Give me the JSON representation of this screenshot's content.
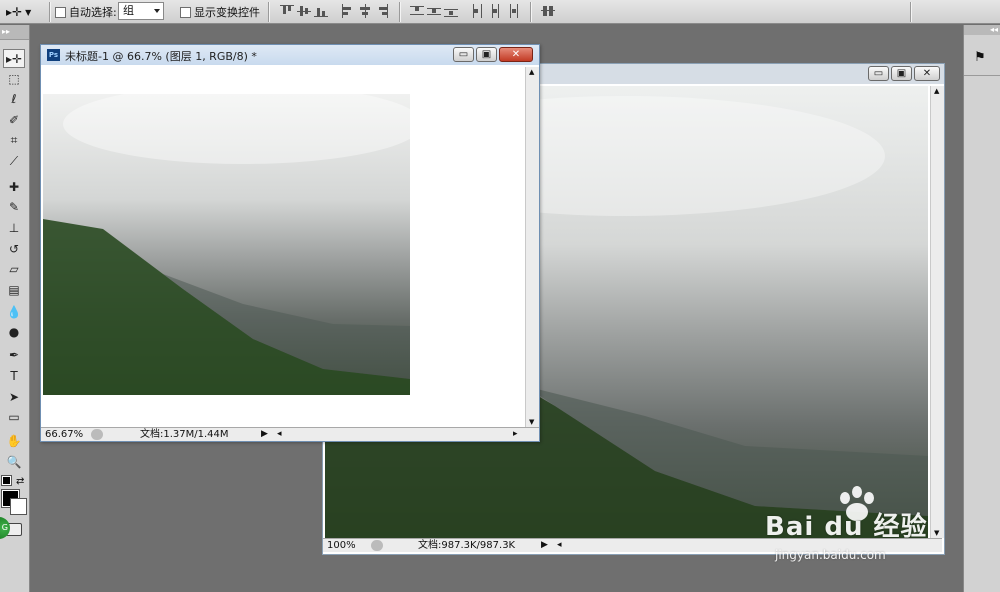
{
  "options_bar": {
    "move_tool_glyph": "▸✛",
    "auto_select_label": "自动选择:",
    "auto_select_value": "组",
    "show_transform_label": "显示变换控件"
  },
  "doc_front": {
    "title": "未标题-1 @ 66.7% (图层 1, RGB/8) *",
    "ps_badge": "Ps",
    "zoom": "66.67%",
    "doc_info": "文档:1.37M/1.44M"
  },
  "doc_back": {
    "zoom": "100%",
    "doc_info": "文档:987.3K/987.3K"
  },
  "icons": {
    "minimize": "▭",
    "restore": "▣",
    "close": "✕",
    "arrow_up": "▲",
    "arrow_down": "▼",
    "arrow_left": "◂",
    "arrow_right": "▸",
    "play": "▶"
  },
  "tools": [
    {
      "name": "move-tool",
      "glyph": "▸✛"
    },
    {
      "name": "marquee-tool",
      "glyph": "⬚"
    },
    {
      "name": "lasso-tool",
      "glyph": "ℓ"
    },
    {
      "name": "quick-select-tool",
      "glyph": "✐"
    },
    {
      "name": "crop-tool",
      "glyph": "⌗"
    },
    {
      "name": "eyedropper-tool",
      "glyph": "⟋"
    },
    {
      "name": "healing-brush-tool",
      "glyph": "✚"
    },
    {
      "name": "brush-tool",
      "glyph": "✎"
    },
    {
      "name": "clone-stamp-tool",
      "glyph": "⊥"
    },
    {
      "name": "history-brush-tool",
      "glyph": "↺"
    },
    {
      "name": "eraser-tool",
      "glyph": "▱"
    },
    {
      "name": "gradient-tool",
      "glyph": "▤"
    },
    {
      "name": "blur-tool",
      "glyph": "💧"
    },
    {
      "name": "dodge-tool",
      "glyph": "●"
    },
    {
      "name": "pen-tool",
      "glyph": "✒"
    },
    {
      "name": "type-tool",
      "glyph": "T"
    },
    {
      "name": "path-select-tool",
      "glyph": "➤"
    },
    {
      "name": "shape-tool",
      "glyph": "▭"
    },
    {
      "name": "hand-tool",
      "glyph": "✋"
    },
    {
      "name": "zoom-tool",
      "glyph": "🔍"
    }
  ],
  "colors": {
    "foreground": "#000000",
    "background": "#ffffff",
    "title_active": "#c8daee",
    "title_inactive": "#d6dde5"
  },
  "watermark": {
    "brand": "Bai du 经验",
    "url": "jingyan.baidu.com"
  }
}
